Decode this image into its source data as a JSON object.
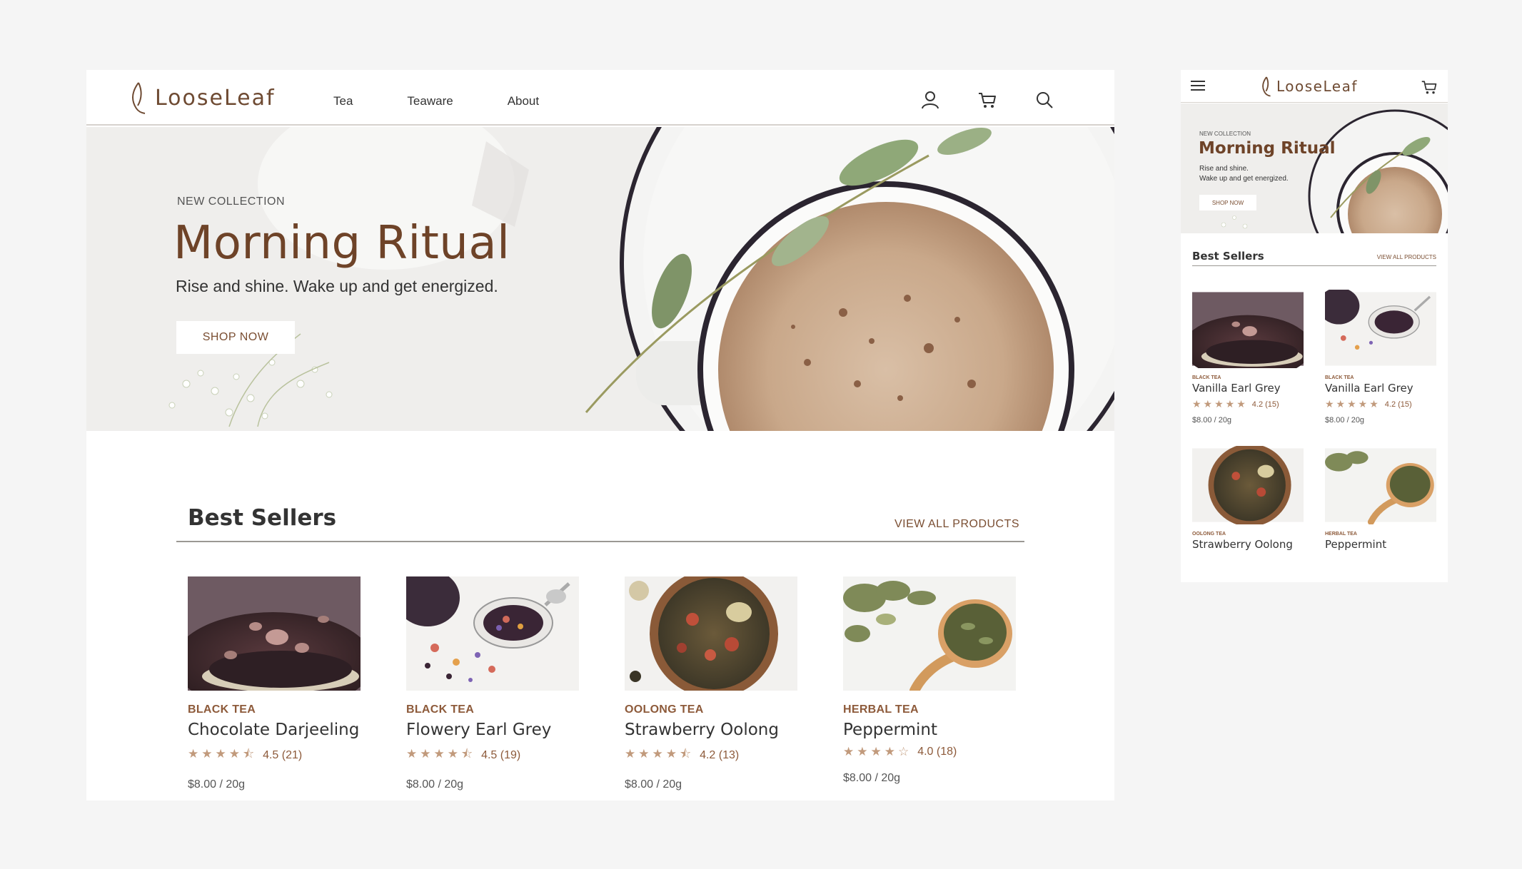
{
  "brand": {
    "name": "LooseLeaf",
    "color": "#6e4a32",
    "accent": "#8d5a3a"
  },
  "nav": {
    "items": [
      "Tea",
      "Teaware",
      "About"
    ]
  },
  "icons": {
    "account": "user-icon",
    "cart": "cart-icon",
    "search": "search-icon",
    "menu": "hamburger-menu-icon"
  },
  "hero": {
    "eyebrow": "NEW COLLECTION",
    "title": "Morning Ritual",
    "subtitle": "Rise and shine. Wake up and get energized.",
    "cta": "SHOP NOW"
  },
  "best_sellers": {
    "title": "Best Sellers",
    "view_all": "VIEW ALL PRODUCTS",
    "products": [
      {
        "category": "BLACK TEA",
        "name": "Chocolate Darjeeling",
        "stars": "★★★★⯪",
        "rating": "4.5 (21)",
        "price": "$8.00 / 20g"
      },
      {
        "category": "BLACK TEA",
        "name": "Flowery Earl Grey",
        "stars": "★★★★⯪",
        "rating": "4.5 (19)",
        "price": "$8.00 / 20g"
      },
      {
        "category": "OOLONG TEA",
        "name": "Strawberry Oolong",
        "stars": "★★★★⯪",
        "rating": "4.2 (13)",
        "price": "$8.00 / 20g"
      },
      {
        "category": "HERBAL TEA",
        "name": "Peppermint",
        "stars": "★★★★☆",
        "rating": "4.0 (18)",
        "price": "$8.00 / 20g"
      }
    ]
  },
  "mobile": {
    "hero": {
      "eyebrow": "NEW COLLECTION",
      "title": "Morning Ritual",
      "subtitle_line1": "Rise and shine.",
      "subtitle_line2": "Wake up and get energized.",
      "cta": "SHOP NOW"
    },
    "best_sellers": {
      "title": "Best Sellers",
      "view_all": "VIEW ALL PRODUCTS",
      "products": [
        {
          "category": "BLACK TEA",
          "name": "Vanilla Earl Grey",
          "stars": "★★★★★",
          "rating": "4.2 (15)",
          "price": "$8.00 / 20g"
        },
        {
          "category": "BLACK TEA",
          "name": "Vanilla Earl Grey",
          "stars": "★★★★★",
          "rating": "4.2 (15)",
          "price": "$8.00 / 20g"
        },
        {
          "category": "OOLONG TEA",
          "name": "Strawberry Oolong"
        },
        {
          "category": "HERBAL TEA",
          "name": "Peppermint"
        }
      ]
    }
  }
}
